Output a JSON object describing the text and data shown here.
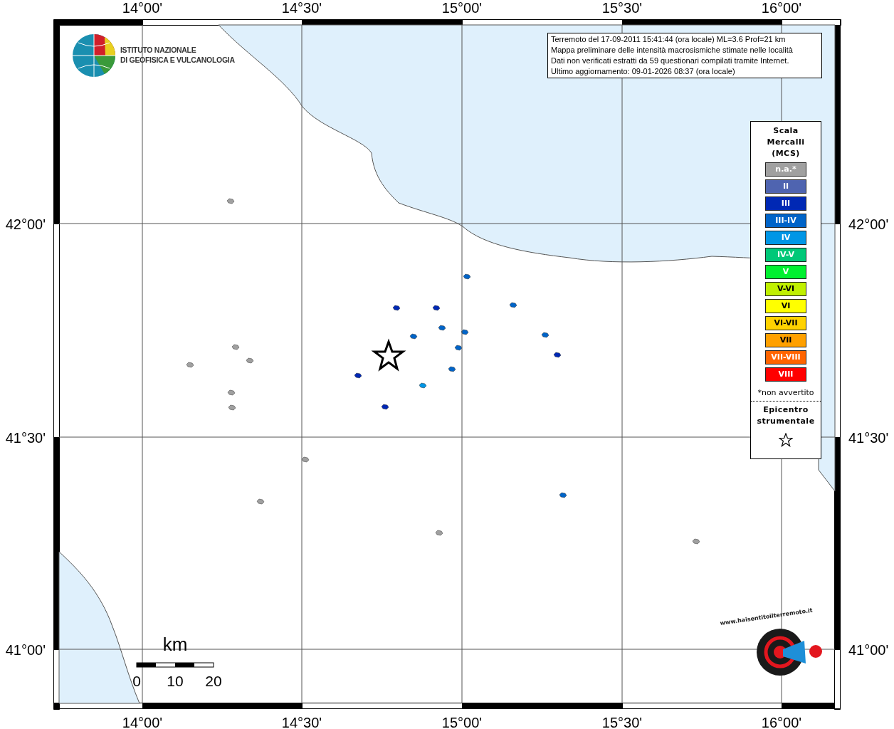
{
  "axes": {
    "top": [
      "14°00'",
      "14°30'",
      "15°00'",
      "15°30'",
      "16°00'"
    ],
    "bottom": [
      "14°00'",
      "14°30'",
      "15°00'",
      "15°30'",
      "16°00'"
    ],
    "left": [
      "42°00'",
      "41°30'",
      "41°00'"
    ],
    "right": [
      "42°00'",
      "41°30'",
      "41°00'"
    ]
  },
  "logo": {
    "lines": [
      "ISTITUTO NAZIONALE",
      "DI GEOFISICA E VULCANOLOGIA"
    ]
  },
  "info_box": {
    "lines": [
      "Terremoto del 17-09-2011 15:41:44 (ora locale) ML=3.6 Prof=21 km",
      "Mappa preliminare delle intensità macrosismiche stimate nelle località",
      "Dati non verificati estratti da 59 questionari compilati tramite Internet.",
      "Ultimo aggiornamento: 09-01-2026 08:37 (ora locale)"
    ]
  },
  "legend": {
    "title_lines": [
      "Scala",
      "Mercalli",
      "(MCS)"
    ],
    "items": [
      {
        "label": "n.a.*",
        "color": "#a0a0a0"
      },
      {
        "label": "II",
        "color": "#4f64b0"
      },
      {
        "label": "III",
        "color": "#0028b4"
      },
      {
        "label": "III-IV",
        "color": "#0064c8"
      },
      {
        "label": "IV",
        "color": "#0096e6"
      },
      {
        "label": "IV-V",
        "color": "#00c878"
      },
      {
        "label": "V",
        "color": "#00f030"
      },
      {
        "label": "V-VI",
        "color": "#c0f000"
      },
      {
        "label": "VI",
        "color": "#ffff00"
      },
      {
        "label": "VI-VII",
        "color": "#ffd200"
      },
      {
        "label": "VII",
        "color": "#ffa000"
      },
      {
        "label": "VII-VIII",
        "color": "#ff6400"
      },
      {
        "label": "VIII",
        "color": "#ff0000"
      }
    ],
    "footnote": "*non avvertito",
    "epicentre_lines": [
      "Epicentro",
      "strumentale"
    ]
  },
  "scale_bar": {
    "unit": "km",
    "ticks": [
      "0",
      "10",
      "20"
    ]
  },
  "badge": {
    "text": "www.haisentitoilterremoto.it"
  }
}
